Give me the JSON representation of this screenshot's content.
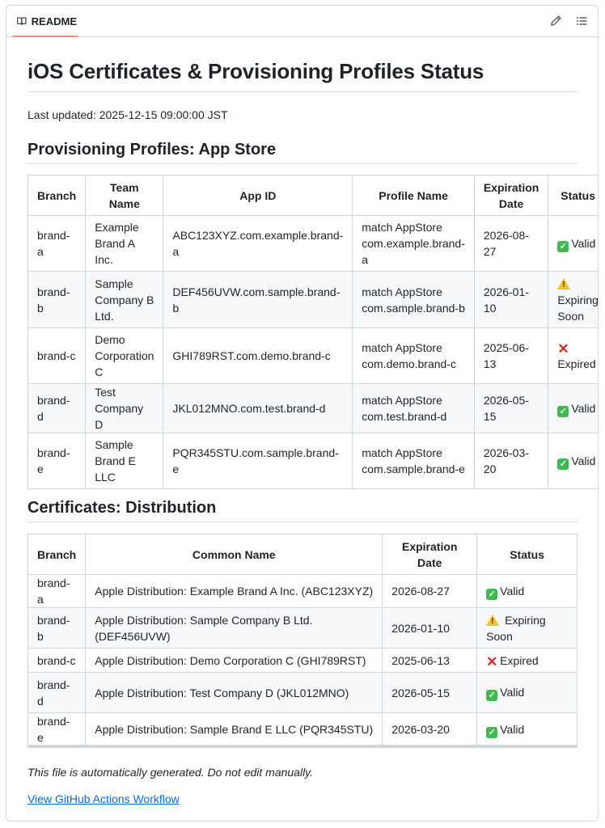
{
  "header": {
    "tab_label": "README",
    "icons": [
      "book-icon",
      "pencil-icon",
      "list-icon"
    ]
  },
  "doc": {
    "title": "iOS Certificates & Provisioning Profiles Status",
    "last_updated": "Last updated: 2025-12-15 09:00:00 JST",
    "profiles": {
      "heading": "Provisioning Profiles: App Store",
      "columns": [
        "Branch",
        "Team Name",
        "App ID",
        "Profile Name",
        "Expiration Date",
        "Status"
      ],
      "rows": [
        {
          "branch": "brand-a",
          "team": "Example Brand A Inc.",
          "app_id": "ABC123XYZ.com.example.brand-a",
          "profile": "match AppStore com.example.brand-a",
          "expiration": "2026-08-27",
          "status": "Valid"
        },
        {
          "branch": "brand-b",
          "team": "Sample Company B Ltd.",
          "app_id": "DEF456UVW.com.sample.brand-b",
          "profile": "match AppStore com.sample.brand-b",
          "expiration": "2026-01-10",
          "status": "Expiring Soon"
        },
        {
          "branch": "brand-c",
          "team": "Demo Corporation C",
          "app_id": "GHI789RST.com.demo.brand-c",
          "profile": "match AppStore com.demo.brand-c",
          "expiration": "2025-06-13",
          "status": "Expired"
        },
        {
          "branch": "brand-d",
          "team": "Test Company D",
          "app_id": "JKL012MNO.com.test.brand-d",
          "profile": "match AppStore com.test.brand-d",
          "expiration": "2026-05-15",
          "status": "Valid"
        },
        {
          "branch": "brand-e",
          "team": "Sample Brand E LLC",
          "app_id": "PQR345STU.com.sample.brand-e",
          "profile": "match AppStore com.sample.brand-e",
          "expiration": "2026-03-20",
          "status": "Valid"
        }
      ]
    },
    "certificates": {
      "heading": "Certificates: Distribution",
      "columns": [
        "Branch",
        "Common Name",
        "Expiration Date",
        "Status"
      ],
      "rows": [
        {
          "branch": "brand-a",
          "common_name": "Apple Distribution: Example Brand A Inc. (ABC123XYZ)",
          "expiration": "2026-08-27",
          "status": "Valid"
        },
        {
          "branch": "brand-b",
          "common_name": "Apple Distribution: Sample Company B Ltd. (DEF456UVW)",
          "expiration": "2026-01-10",
          "status": "Expiring Soon"
        },
        {
          "branch": "brand-c",
          "common_name": "Apple Distribution: Demo Corporation C (GHI789RST)",
          "expiration": "2025-06-13",
          "status": "Expired"
        },
        {
          "branch": "brand-d",
          "common_name": "Apple Distribution: Test Company D (JKL012MNO)",
          "expiration": "2026-05-15",
          "status": "Valid"
        },
        {
          "branch": "brand-e",
          "common_name": "Apple Distribution: Sample Brand E LLC (PQR345STU)",
          "expiration": "2026-03-20",
          "status": "Valid"
        }
      ]
    },
    "footer_note": "This file is automatically generated. Do not edit manually.",
    "footer_link": "View GitHub Actions Workflow"
  },
  "colors": {
    "accent": "#fd8c73",
    "link": "#0969da",
    "valid": "#3fb950",
    "warning": "#f2c21b",
    "expired": "#d42b2b"
  }
}
